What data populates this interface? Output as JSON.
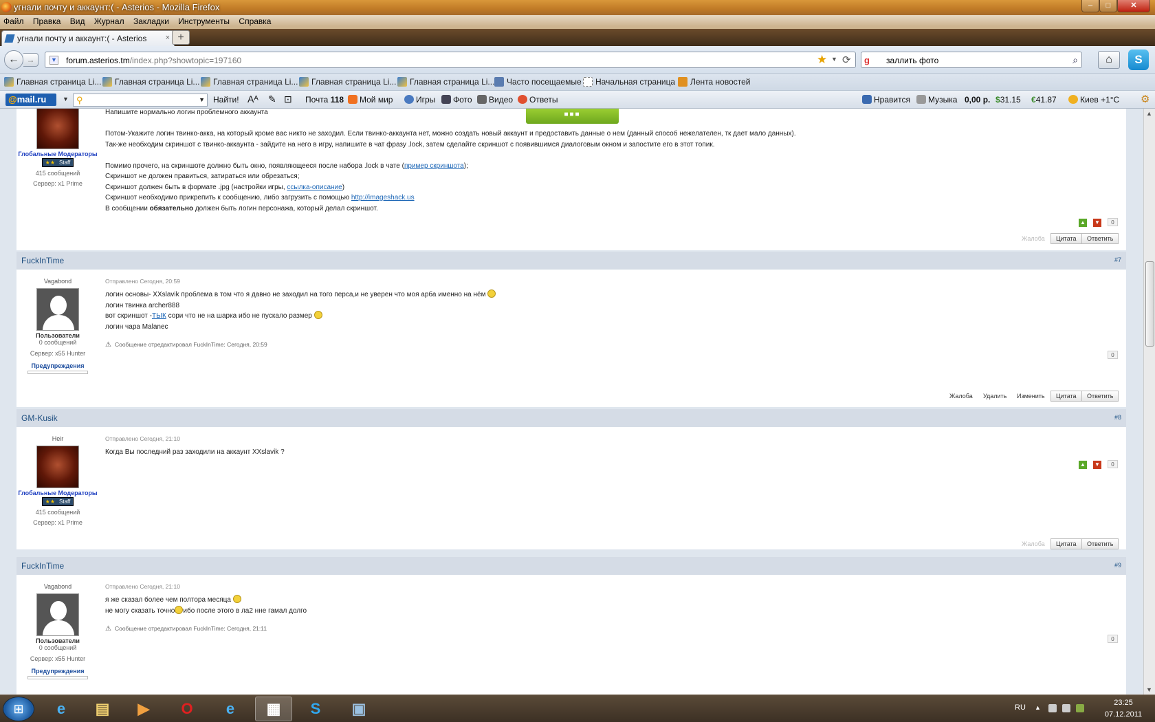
{
  "window": {
    "title": "угнали почту и аккаунт:( - Asterios - Mozilla Firefox",
    "minimize": "‒",
    "maximize": "□",
    "close": "✕"
  },
  "menu": [
    "Файл",
    "Правка",
    "Вид",
    "Журнал",
    "Закладки",
    "Инструменты",
    "Справка"
  ],
  "tab": {
    "label": "угнали почту и аккаунт:( - Asterios",
    "close": "×",
    "new": "+"
  },
  "nav": {
    "back": "←",
    "forward": "→",
    "url_domain": "forum.asterios.tm",
    "url_path": "/index.php?showtopic=197160",
    "star": "★",
    "reload": "⟳",
    "search_engine": "g",
    "search_value": "заллить фото",
    "home": "⌂",
    "skype": "S"
  },
  "bookmarks": [
    {
      "label": "Главная страница Li...",
      "icon": "liveinternet-icon"
    },
    {
      "label": "Главная страница Li...",
      "icon": "liveinternet-icon"
    },
    {
      "label": "Главная страница Li...",
      "icon": "liveinternet-icon"
    },
    {
      "label": "Главная страница Li...",
      "icon": "liveinternet-icon"
    },
    {
      "label": "Главная страница Li...",
      "icon": "liveinternet-icon"
    },
    {
      "label": "Часто посещаемые",
      "icon": "smart-folder-icon"
    },
    {
      "label": "Начальная страница",
      "icon": "page-icon"
    },
    {
      "label": "Лента новостей",
      "icon": "rss-icon"
    }
  ],
  "mailbar": {
    "logo_at": "@",
    "logo_text": "mail.ru",
    "find": "Найти!",
    "mail": "Почта",
    "mail_count": "118",
    "my_world": "Мой мир",
    "games": "Игры",
    "photo": "Фото",
    "video": "Видео",
    "answers": "Ответы",
    "like": "Нравится",
    "music": "Музыка",
    "balance": "0,00 р.",
    "usd": "31.15",
    "eur": "41.87",
    "weather": "Киев +1°С"
  },
  "post6": {
    "group": "Глобальные Модераторы",
    "staff": "Staff",
    "staff_stars": "★★",
    "messages": "415 сообщений",
    "server": "Сервер: x1 Prime",
    "lines": [
      "Напишите нормально логин проблемного аккаунта",
      "Потом-Укажите логин твинко-акка, на который кроме вас никто не заходил. Если твинко-аккаунта нет, можно создать новый аккаунт и предоставить данные о нем (данный способ нежелателен, тк дает мало данных).",
      "Так-же необходим скриншот с твинко-аккаунта - зайдите на него в игру, напишите в чат фразу .lock, затем сделайте скриншот с появившимся диалоговым окном и запостите его в этот топик.",
      "Помимо прочего, на скриншоте должно быть окно, появляющееся после набора .lock в чате (",
      "пример скриншота",
      ");",
      "Скриншот не должен правиться, затираться или обрезаться;",
      "Скриншот должен быть в формате .jpg (настройки игры, ",
      "ссылка-описание",
      ")",
      "Скриншот необходимо прикрепить к сообщению, либо загрузить с помощью ",
      "http://imageshack.us",
      "В сообщении ",
      "обязательно",
      " должен быть логин персонажа, который делал скриншот."
    ],
    "rep": "0",
    "report": "Жалоба",
    "quote": "Цитата",
    "reply": "Ответить"
  },
  "post7": {
    "author": "FuckInTime",
    "num": "#7",
    "rank": "Vagabond",
    "group": "Пользователи",
    "messages": "0 сообщений",
    "server": "Сервер: x55 Hunter",
    "warnings": "Предупреждения",
    "date": "Отправлено Сегодня, 20:59",
    "line1": "логин основы- XXslavik проблема в том что я давно не заходил на того перса,и не уверен что моя арба именно на нём ",
    "line2": "логин твинка archer888",
    "line3a": "вот скриншот -",
    "line3link": "ТЫК",
    "line3b": " сори что не на шарка ибо не пускало размер ",
    "line4": "логин чара Malanec",
    "edit": "Сообщение отредактировал FuckInTime: Сегодня, 20:59",
    "rep": "0",
    "report": "Жалоба",
    "delete": "Удалить",
    "edit_btn": "Изменить",
    "quote": "Цитата",
    "reply": "Ответить"
  },
  "post8": {
    "author": "GM-Kusik",
    "num": "#8",
    "rank": "Heir",
    "group": "Глобальные Модераторы",
    "staff": "Staff",
    "staff_stars": "★★",
    "messages": "415 сообщений",
    "server": "Сервер: x1 Prime",
    "date": "Отправлено Сегодня, 21:10",
    "line1": "Когда Вы последний раз заходили на аккаунт XXslavik ?",
    "rep": "0",
    "report": "Жалоба",
    "quote": "Цитата",
    "reply": "Ответить"
  },
  "post9": {
    "author": "FuckInTime",
    "num": "#9",
    "rank": "Vagabond",
    "group": "Пользователи",
    "messages": "0 сообщений",
    "server": "Сервер: x55 Hunter",
    "warnings": "Предупреждения",
    "date": "Отправлено Сегодня, 21:10",
    "line1": "я же сказал более чем полтора месяца ",
    "line2a": "не могу сказать точно",
    "line2b": "ибо после этого в ла2 нне гамал долго",
    "edit": "Сообщение отредактировал FuckInTime: Сегодня, 21:11",
    "rep": "0"
  },
  "rep_up": "▲",
  "rep_down": "▼",
  "edit_icon": "⚠",
  "green_tab": "■■■",
  "taskbar": {
    "start": "⊞",
    "items": [
      "e",
      "▤",
      "▶",
      "O",
      "e",
      "▦",
      "S",
      "▣"
    ],
    "lang": "RU",
    "time": "23:25",
    "date": "07.12.2011"
  }
}
